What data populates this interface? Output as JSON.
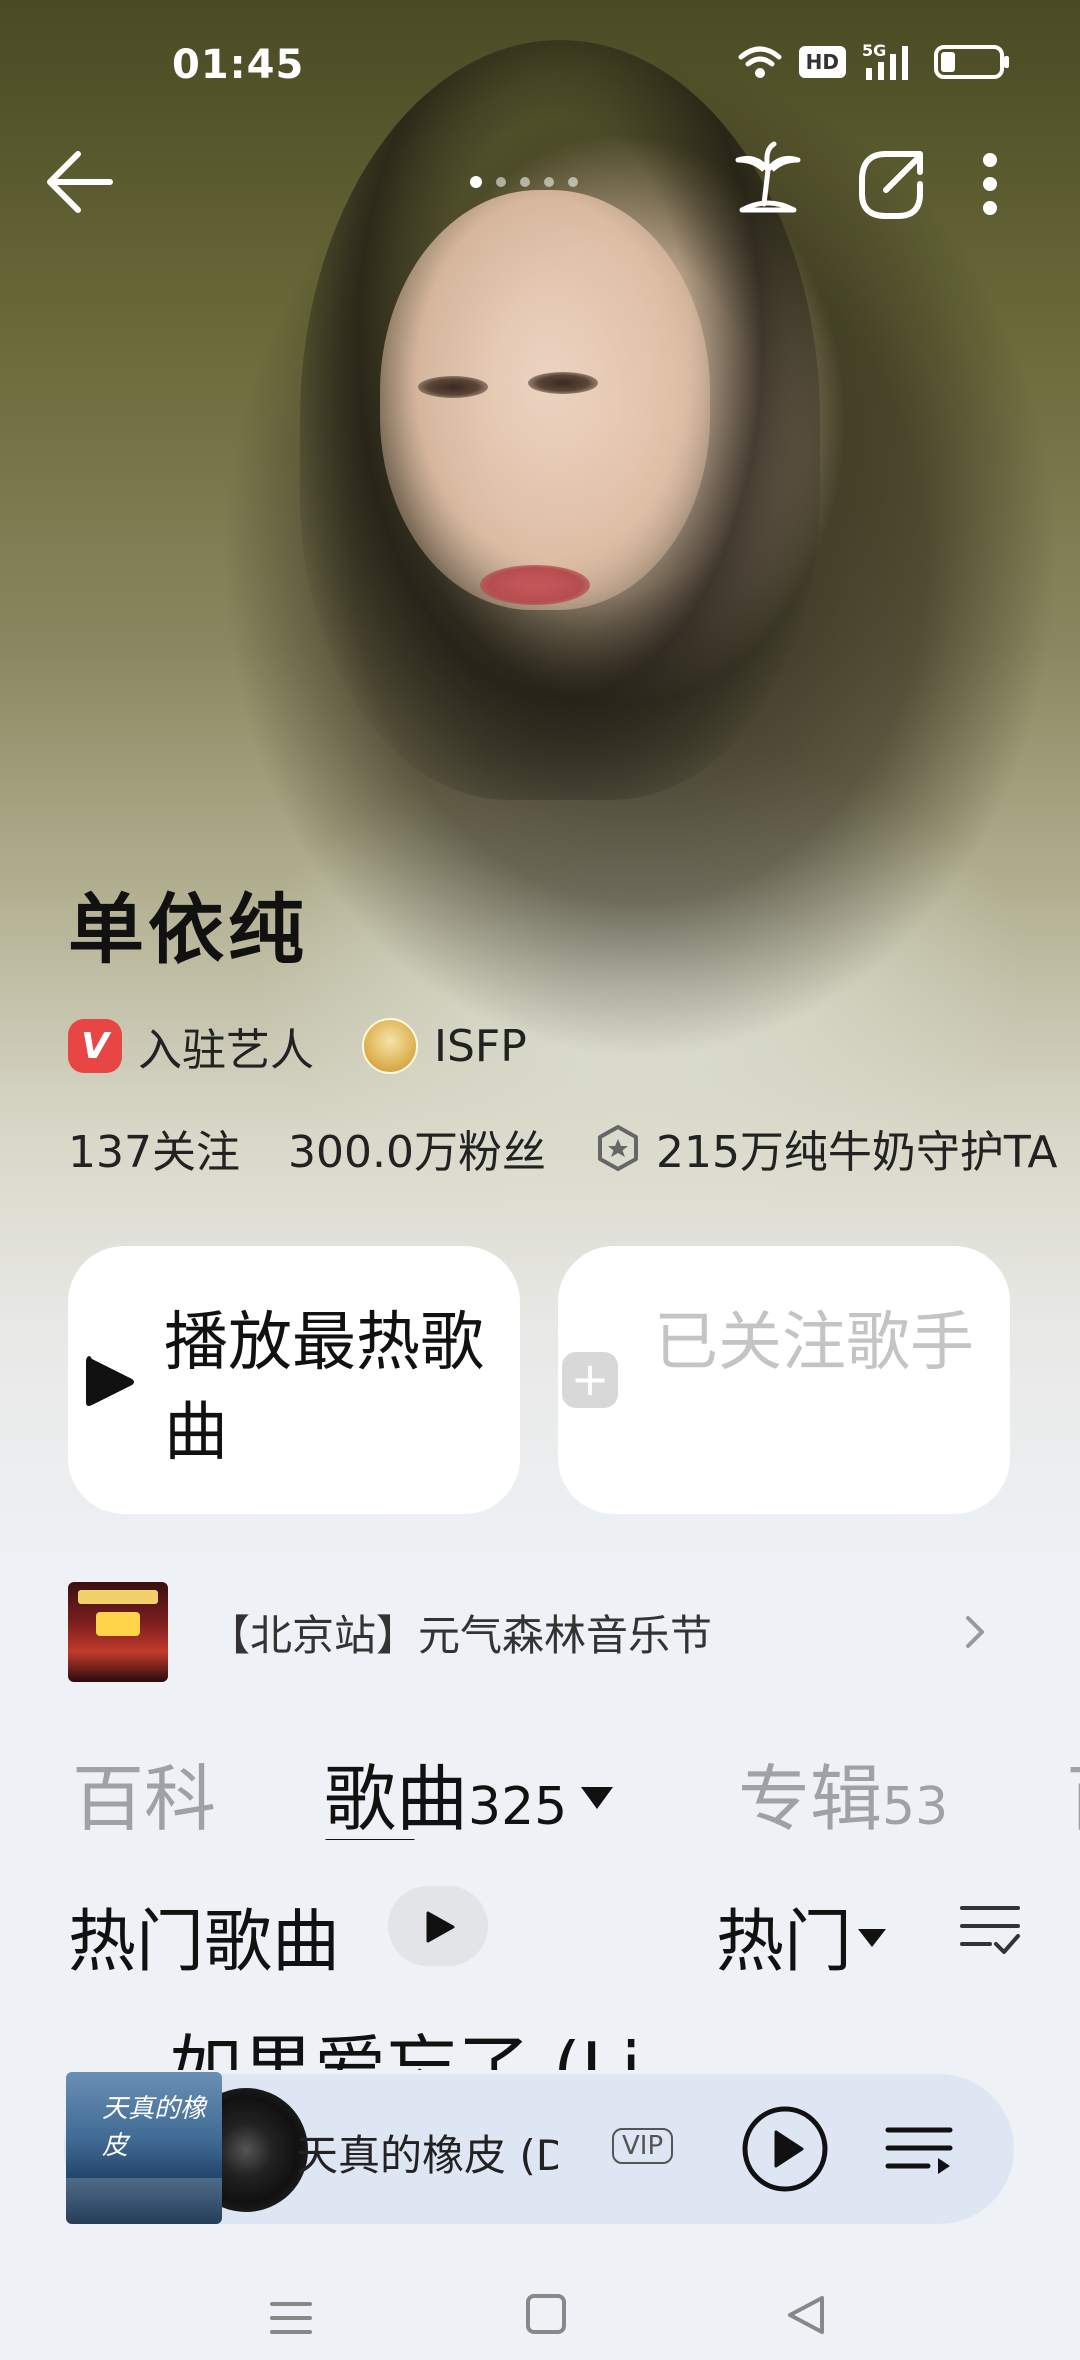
{
  "status_bar": {
    "time": "01:45",
    "hd_badge": "HD",
    "network": "5G"
  },
  "top_nav": {
    "page_dots_count": 5,
    "active_dot_index": 0
  },
  "artist": {
    "name": "单依纯",
    "verified_badge_letter": "V",
    "verified_label": "入驻艺人",
    "mbti_label": "ISFP",
    "following": "137关注",
    "followers": "300.0万粉丝",
    "guardians": "215万纯牛奶守护TA"
  },
  "actions": {
    "play_hot_label": "播放最热歌曲",
    "follow_label": "已关注歌手",
    "follow_plus": "+"
  },
  "banner": {
    "text": "【北京站】元气森林音乐节"
  },
  "tabs": {
    "baike": "百科",
    "songs": "歌曲",
    "songs_count": "325",
    "album": "专辑",
    "album_count": "53",
    "more": "百"
  },
  "section": {
    "title": "热门歌曲",
    "sort_label": "热门"
  },
  "song_peek": "如果爱忘了 (Li",
  "player": {
    "album_art_text": "天真的橡皮",
    "title": "天真的橡皮 (DJ",
    "vip": "VIP"
  },
  "colors": {
    "verified": "#e84545",
    "player_bg": "#dfe6f3",
    "page_bg": "#eef1f5"
  },
  "icons": [
    "back-arrow-icon",
    "palm-tree-icon",
    "share-icon",
    "more-vertical-icon",
    "play-icon",
    "plus-icon",
    "chevron-right-icon",
    "caret-down-icon",
    "list-filter-icon",
    "play-circle-icon",
    "queue-icon",
    "wifi-icon",
    "signal-icon",
    "battery-icon"
  ]
}
